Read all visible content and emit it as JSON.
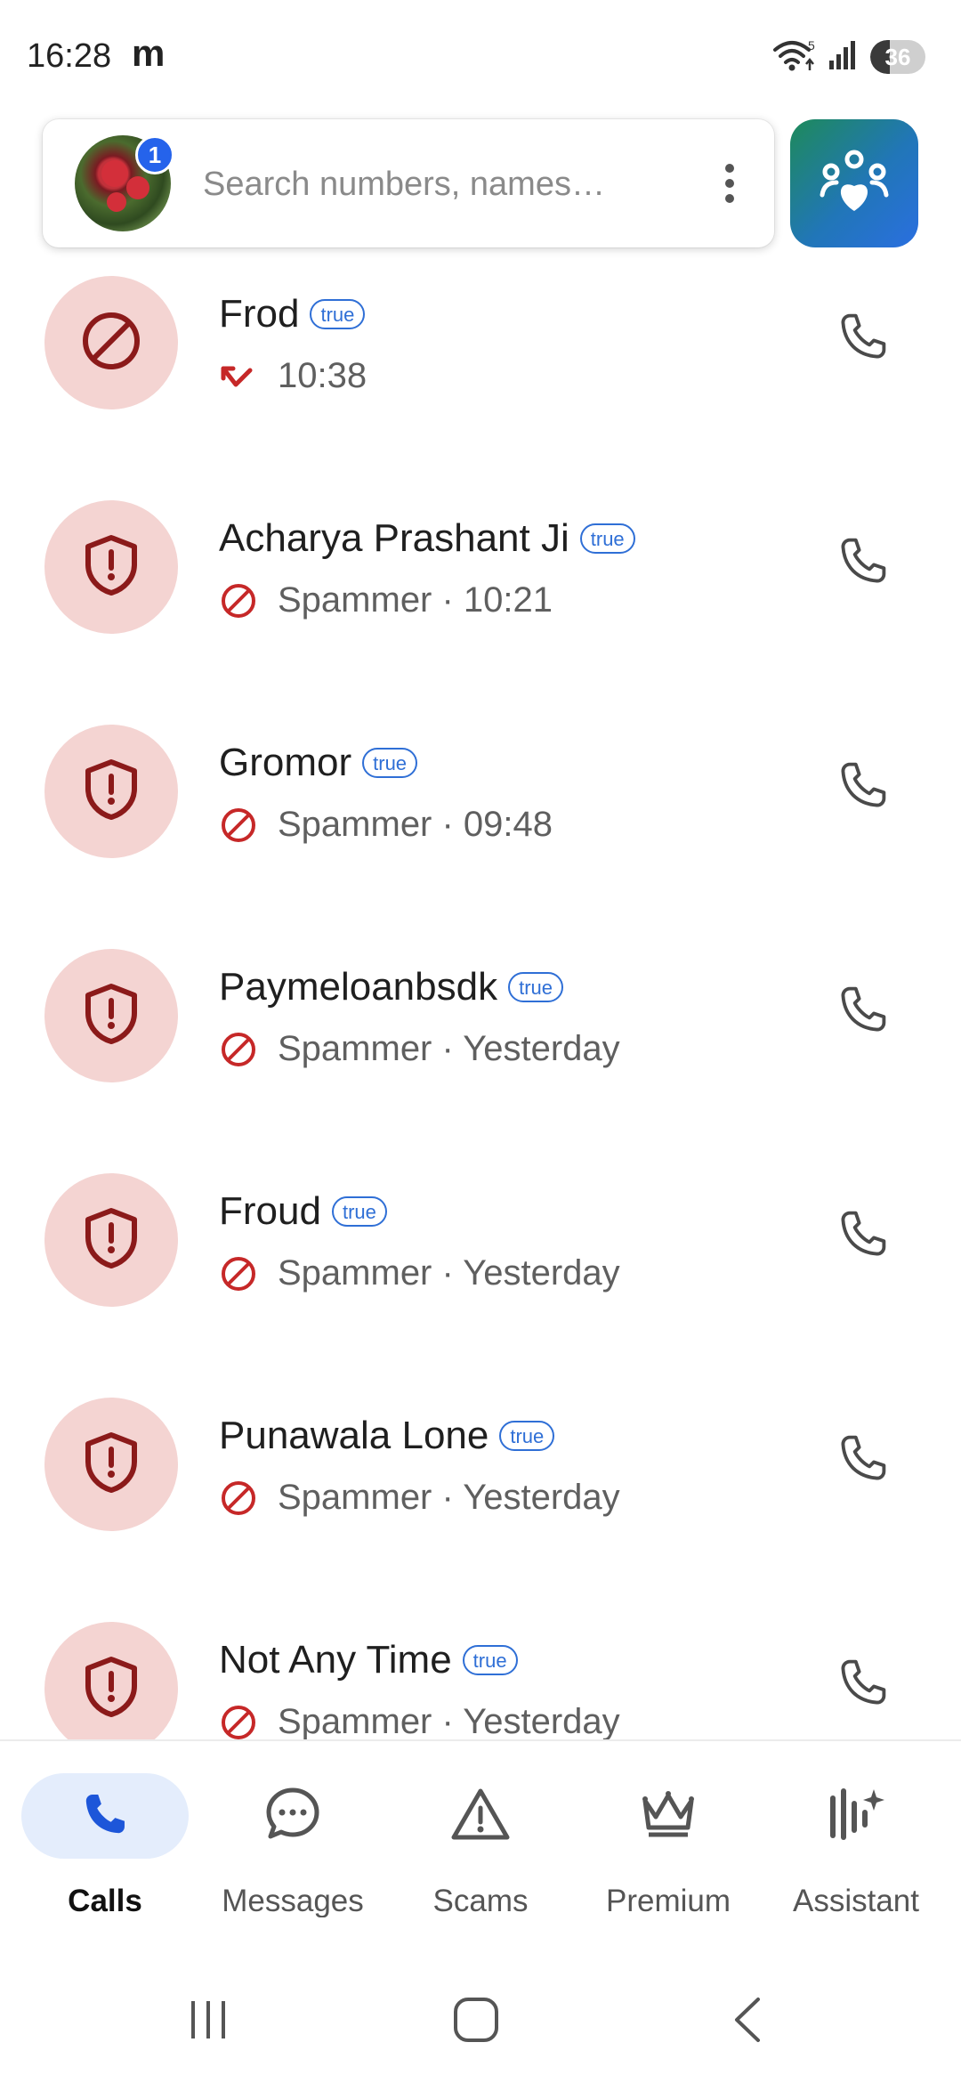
{
  "status_bar": {
    "time": "16:28",
    "notif_letter": "m",
    "wifi_label": "5",
    "battery_percent": "36",
    "battery_level": 0.36
  },
  "search": {
    "placeholder": "Search numbers, names…",
    "badge_count": "1"
  },
  "calls": [
    {
      "name": "Frod",
      "tag": "true",
      "subtitle": "10:38",
      "sub_icon": "missed-call-icon",
      "avatar_icon": "block-icon"
    },
    {
      "name": "Acharya Prashant Ji",
      "tag": "true",
      "subtitle": "Spammer · 10:21",
      "sub_icon": "block-icon",
      "avatar_icon": "shield-alert-icon"
    },
    {
      "name": "Gromor",
      "tag": "true",
      "subtitle": "Spammer · 09:48",
      "sub_icon": "block-icon",
      "avatar_icon": "shield-alert-icon"
    },
    {
      "name": "Paymeloanbsdk",
      "tag": "true",
      "subtitle": "Spammer · Yesterday",
      "sub_icon": "block-icon",
      "avatar_icon": "shield-alert-icon"
    },
    {
      "name": "Froud",
      "tag": "true",
      "subtitle": "Spammer · Yesterday",
      "sub_icon": "block-icon",
      "avatar_icon": "shield-alert-icon"
    },
    {
      "name": "Punawala Lone",
      "tag": "true",
      "subtitle": "Spammer · Yesterday",
      "sub_icon": "block-icon",
      "avatar_icon": "shield-alert-icon"
    },
    {
      "name": "Not Any Time",
      "tag": "true",
      "subtitle": "Spammer · Yesterday",
      "sub_icon": "block-icon",
      "avatar_icon": "shield-alert-icon"
    }
  ],
  "bottom_nav": [
    {
      "label": "Calls",
      "icon": "phone-icon",
      "active": true
    },
    {
      "label": "Messages",
      "icon": "chat-bubble-icon",
      "active": false
    },
    {
      "label": "Scams",
      "icon": "warning-triangle-icon",
      "active": false
    },
    {
      "label": "Premium",
      "icon": "crown-icon",
      "active": false
    },
    {
      "label": "Assistant",
      "icon": "assistant-sparkle-icon",
      "active": false
    }
  ],
  "colors": {
    "accent_blue": "#2563eb",
    "spam_red": "#c62828",
    "avatar_bg": "#f4d4d2",
    "shield_dark_red": "#8b1a1a",
    "active_nav_bg": "#e4edfc"
  }
}
